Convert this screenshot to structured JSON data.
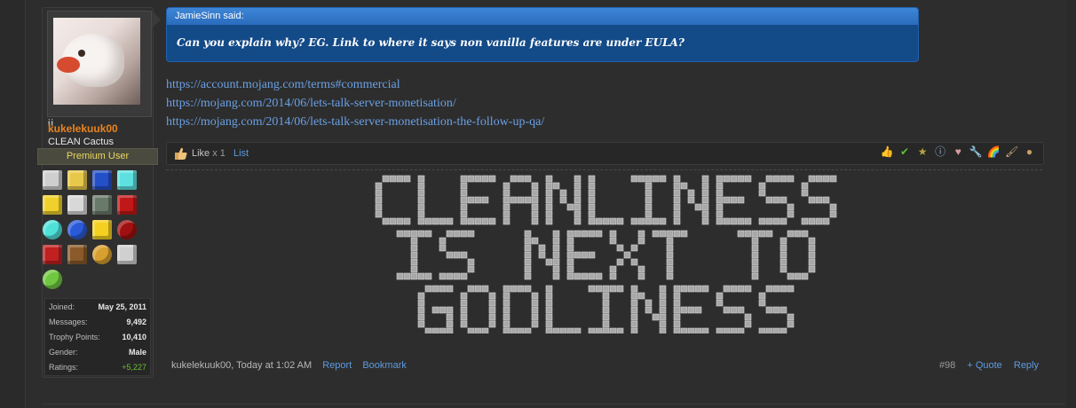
{
  "user": {
    "username": "kukelekuuk00",
    "title": "CLEAN Cactus",
    "banner": "Premium User",
    "stats": [
      {
        "label": "Joined:",
        "value": "May 25, 2011"
      },
      {
        "label": "Messages:",
        "value": "9,492"
      },
      {
        "label": "Trophy Points:",
        "value": "10,410"
      },
      {
        "label": "Gender:",
        "value": "Male"
      },
      {
        "label": "Ratings:",
        "value": "+5,227"
      }
    ],
    "trophy_icons": [
      "iron-ingot-icon",
      "crown-icon",
      "lapis-block-icon",
      "diamond-block-icon",
      "gold-block-icon",
      "iron-block-icon",
      "chiseled-block-icon",
      "redstone-block-icon",
      "diamond-icon",
      "lapis-icon",
      "gold-ingot-icon",
      "redstone-icon",
      "checkbox-icon",
      "chest-icon",
      "cookie-icon",
      "key-icon",
      "slimeball-icon"
    ]
  },
  "quote": {
    "author": "JamieSinn said:",
    "text": "Can you explain why? EG. Link to where it says non vanilla features are under EULA?"
  },
  "links": [
    "https://account.mojang.com/terms#commercial",
    "https://mojang.com/2014/06/lets-talk-server-monetisation/",
    "https://mojang.com/2014/06/lets-talk-server-monetisation-the-follow-up-qa/"
  ],
  "likes": {
    "label": "Like",
    "count": "x 1",
    "list": "List",
    "rating_icons": [
      "thumbs-up-icon",
      "check-icon",
      "trophy-icon",
      "info-icon",
      "heart-icon",
      "wrench-icon",
      "rainbow-icon",
      "paintbrush-icon",
      "potato-icon"
    ]
  },
  "signature_image": {
    "lines": [
      "CLEANLINESS",
      "IS NEXT TO",
      "GODLINESS"
    ]
  },
  "footer": {
    "author_time": "kukelekuuk00, Today at 1:02 AM",
    "report": "Report",
    "bookmark": "Bookmark",
    "post_number": "#98",
    "quote": "+ Quote",
    "reply": "Reply"
  },
  "colors": {
    "username": "#e88420",
    "link": "#6ba0e4",
    "quote_bg": "#134a88",
    "rating_positive": "#6cbf3b"
  }
}
